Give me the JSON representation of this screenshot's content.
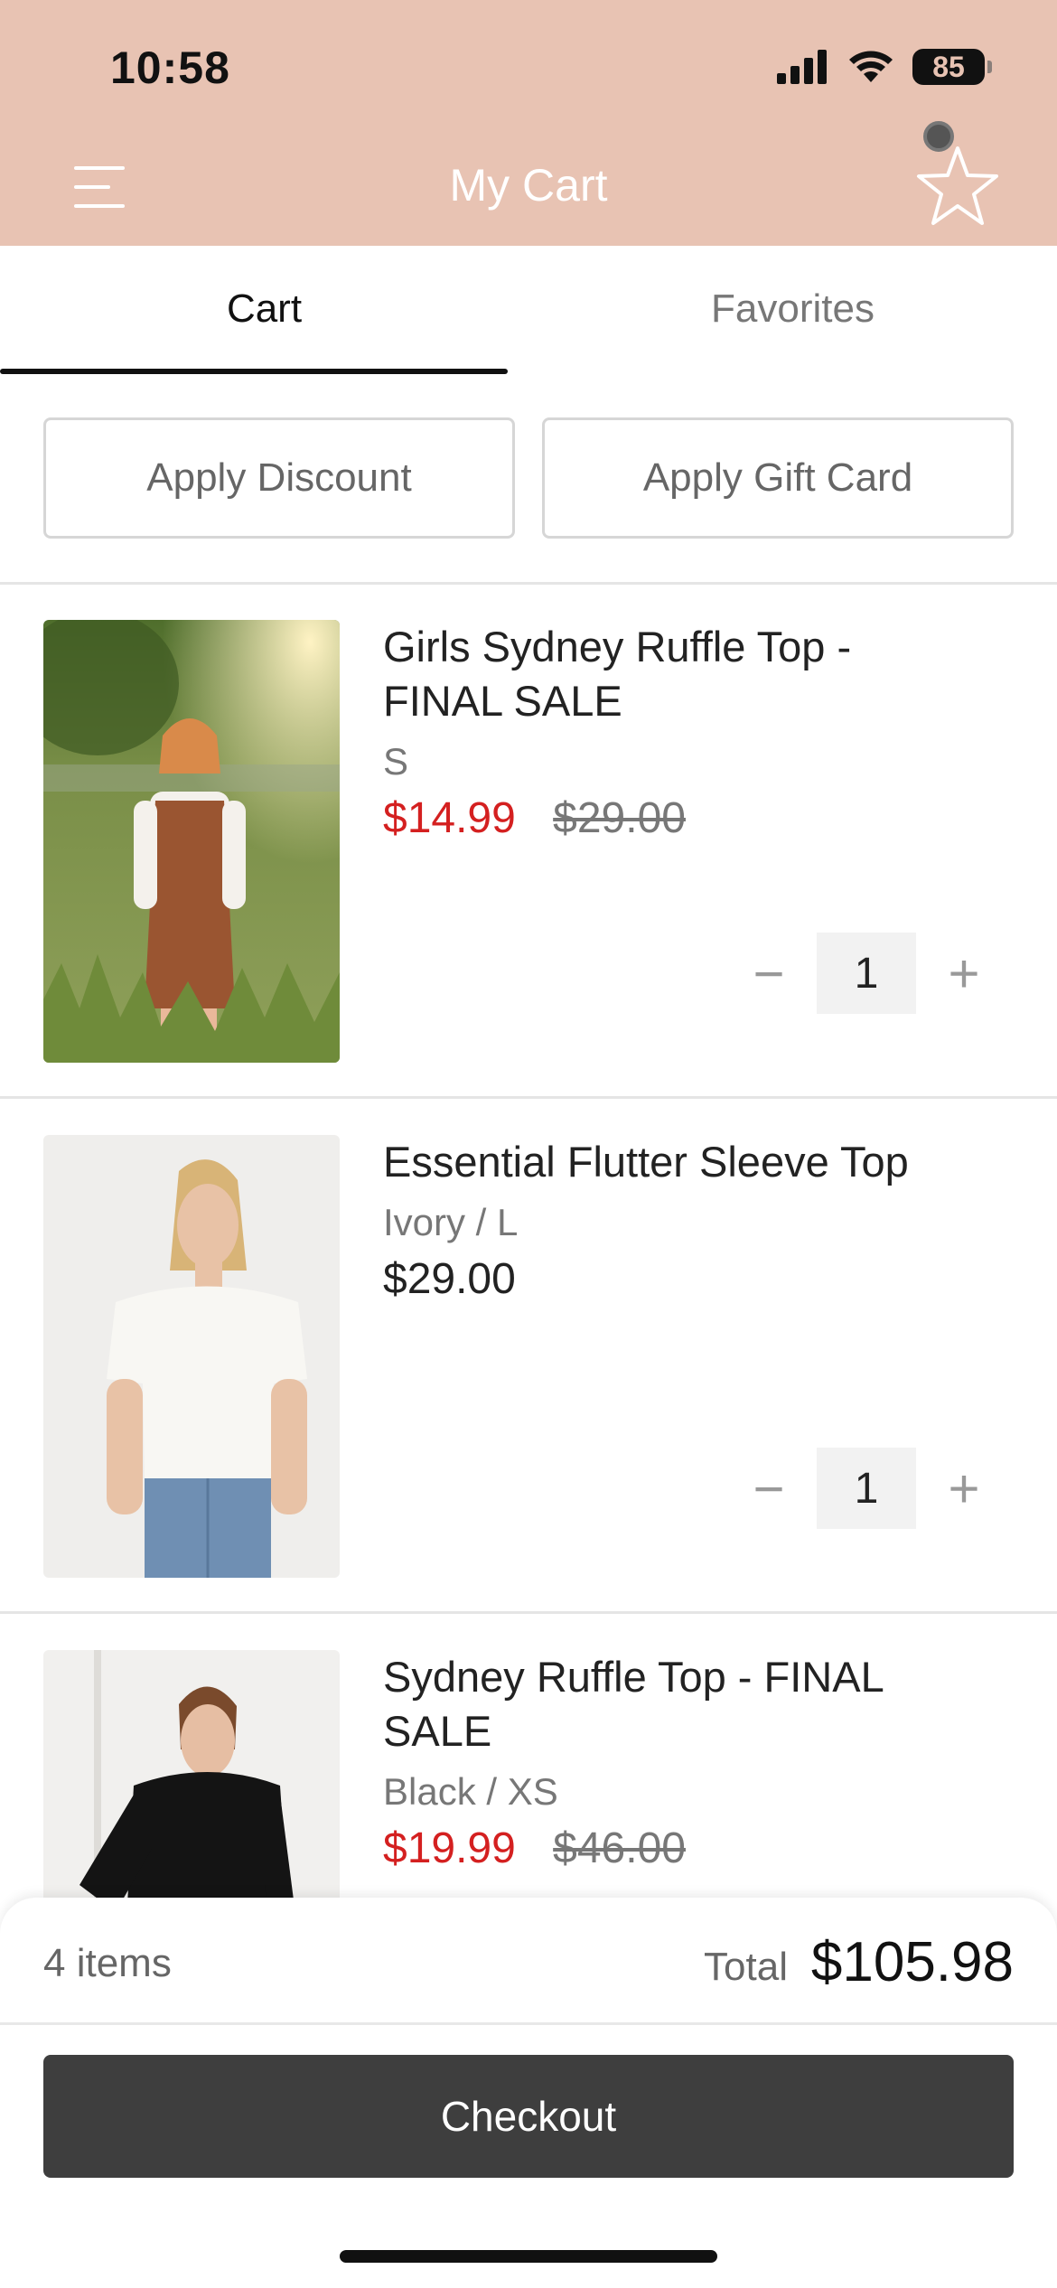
{
  "status_bar": {
    "time": "10:58",
    "battery": "85"
  },
  "header": {
    "title": "My Cart",
    "menu_icon": "menu-icon",
    "favorite_icon": "star-icon"
  },
  "tabs": [
    {
      "label": "Cart",
      "active": true
    },
    {
      "label": "Favorites",
      "active": false
    }
  ],
  "actions": {
    "apply_discount": "Apply Discount",
    "apply_gift_card": "Apply Gift Card"
  },
  "items": [
    {
      "name": "Girls Sydney Ruffle Top - FINAL SALE",
      "variant": "S",
      "sale_price": "$14.99",
      "original_price": "$29.00",
      "quantity": "1"
    },
    {
      "name": "Essential Flutter Sleeve Top",
      "variant": "Ivory / L",
      "price": "$29.00",
      "quantity": "1"
    },
    {
      "name": "Sydney Ruffle Top - FINAL SALE",
      "variant": "Black / XS",
      "sale_price": "$19.99",
      "original_price": "$46.00"
    }
  ],
  "qty_controls": {
    "minus": "−",
    "plus": "+"
  },
  "summary": {
    "items_count": "4 items",
    "total_label": "Total",
    "total_value": "$105.98",
    "checkout_label": "Checkout"
  },
  "colors": {
    "header_bg": "#e8c3b3",
    "sale_red": "#d42020",
    "checkout_bg": "#3e3e3e"
  }
}
